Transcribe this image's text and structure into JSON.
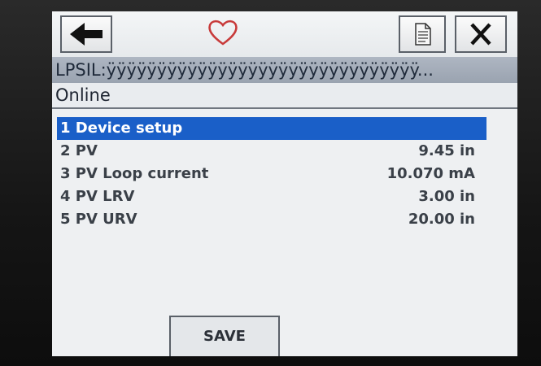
{
  "toolbar": {
    "back_icon": "arrow-left-icon",
    "favorite_icon": "heart-icon",
    "document_icon": "document-icon",
    "close_icon": "close-icon",
    "heart_color": "#c83a3a"
  },
  "device": {
    "tag": "LPSIL:ÿÿÿÿÿÿÿÿÿÿÿÿÿÿÿÿÿÿÿÿÿÿÿÿÿÿÿÿÿÿÿ...",
    "status": "Online"
  },
  "menu": {
    "items": [
      {
        "label": "1 Device setup",
        "value": ""
      },
      {
        "label": "2 PV",
        "value": "9.45 in"
      },
      {
        "label": "3 PV Loop current",
        "value": "10.070 mA"
      },
      {
        "label": "4 PV LRV",
        "value": "3.00 in"
      },
      {
        "label": "5 PV URV",
        "value": "20.00 in"
      }
    ],
    "selected_index": 0,
    "selected_color": "#1a5fc8"
  },
  "footer": {
    "save_label": "SAVE"
  }
}
